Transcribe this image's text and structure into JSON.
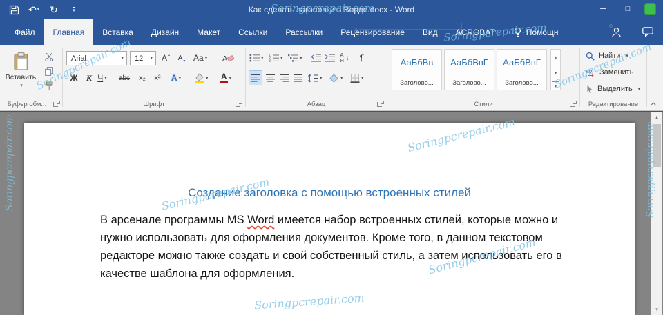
{
  "window": {
    "title": "Как сделать заголовки в Ворде.docx - Word"
  },
  "icons": {
    "undo": "↶",
    "redo": "↻",
    "caret": "▾",
    "minimize": "─",
    "maximize": "□",
    "pilcrow": "¶",
    "arrow_down": "↓",
    "gallery_up": "▴",
    "gallery_down": "▾"
  },
  "tabs": {
    "file": "Файл",
    "home": "Главная",
    "insert": "Вставка",
    "design": "Дизайн",
    "layout": "Макет",
    "references": "Ссылки",
    "mailings": "Рассылки",
    "review": "Рецензирование",
    "view": "Вид",
    "acrobat": "ACROBAT",
    "assistant": "Помощн"
  },
  "ribbon": {
    "clipboard": {
      "group_label": "Буфер обм...",
      "paste_label": "Вставить"
    },
    "font": {
      "group_label": "Шрифт",
      "font_name": "Arial",
      "font_size": "12",
      "grow_font": "А",
      "shrink_font": "А",
      "change_case": "Aa",
      "bold": "Ж",
      "italic": "К",
      "underline": "Ч",
      "strikethrough": "abc",
      "subscript": "x₂",
      "superscript": "x²",
      "text_effects": "А",
      "font_color": "А"
    },
    "paragraph": {
      "group_label": "Абзац",
      "sort_letters": "АЯ"
    },
    "styles": {
      "group_label": "Стили",
      "items": [
        {
          "preview": "АаБбВв",
          "label": "Заголово..."
        },
        {
          "preview": "АаБбВвГ",
          "label": "Заголово..."
        },
        {
          "preview": "АаБбВвГ",
          "label": "Заголово..."
        }
      ]
    },
    "editing": {
      "group_label": "Редактирование",
      "find": "Найти",
      "replace": "Заменить",
      "select": "Выделить"
    }
  },
  "document": {
    "heading": "Создание заголовка с помощью встроенных стилей",
    "para_before": "В арсенале программы MS ",
    "para_misspelled": "Word",
    "para_after": " имеется набор встроенных стилей, которые можно и нужно использовать для оформления документов. Кроме того, в данном текстовом редакторе можно также создать и свой собственный стиль, а затем использовать его в качестве шаблона для оформления."
  },
  "watermark": "Soringpcrepair.com",
  "colors": {
    "titlebar_accent": "#2b579a",
    "ribbon_background": "#f3f3f3",
    "document_background": "#848484",
    "heading_text": "#2e75b6",
    "spellcheck_squiggle": "#e5432e",
    "watermark_text": "#7cc3e6",
    "green_badge": "#3fbf4e"
  }
}
